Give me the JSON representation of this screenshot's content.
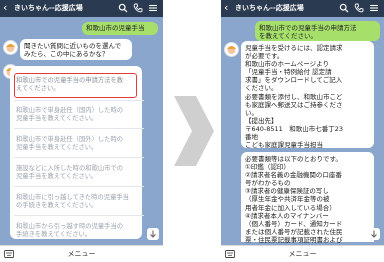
{
  "app": {
    "title": "きいちゃん--応援広場",
    "back_glyph": "‹",
    "icons": [
      "search-icon",
      "phone-icon",
      "menu-icon"
    ],
    "menu_label": "メニュー"
  },
  "left_screen": {
    "user_message": "和歌山市の児童手当",
    "bot_prompt": "聞きたい質問に近いものを選んで\nみたら、この中にあるかな？",
    "choices": [
      "和歌山市での児童手当の申請方法を教\nえてください。",
      "和歌山市で単身赴任（国内）した時の\n児童手当を教えてください。",
      "和歌山市で単身赴任（国外）した時の\n児童手当を教えてください。",
      "施設などに入所した時の和歌山市での\n児童手当を教えてください。",
      "和歌山市に引っ越してきた時の児童手当\nの手続きを教えてください。",
      "和歌山市から引っ越す時の児童手当の\n手続きを教えてください。"
    ],
    "highlighted_choice_index": 0
  },
  "right_screen": {
    "user_message": "和歌山市での児童手当の申請方法\nを教えてください。",
    "bot_answer_1": "児童手当を受けるには、認定請求\nが必要です。\n和歌山市のホームページより\n「児童手当・特例給付 認定請\n求書」をダウンロードしてご記入\nください。\n必要書類を添付し、和歌山市こど\nも家庭課へ郵送又はご持参くださ\nい。\n【提出先】\n〒640-8511　和歌山市七番丁23\n番地\nこども家庭課児童手当担当",
    "bot_answer_2": "必要書類等は以下のとおりです。\n①印鑑（認印）\n②請求者名義の金融機関の口座番\n号がわかるもの\n③請求者の健康保険証の写し\n（厚生年金や共済年金等の被\n用者年金に加入している場合）\n④請求者本人のマイナンバー\n（個人番号）カード、通知カード\nまたは個人番号が記載された住民\n票・住民票記載事項証明書および"
  },
  "colors": {
    "chat_background": "#8aa6cc",
    "header_background": "#2a3a50",
    "user_bubble": "#a6e06b",
    "bot_bubble": "#ffffff",
    "highlight_border": "#e23b3b",
    "choice_text": "#9aa3ad"
  }
}
